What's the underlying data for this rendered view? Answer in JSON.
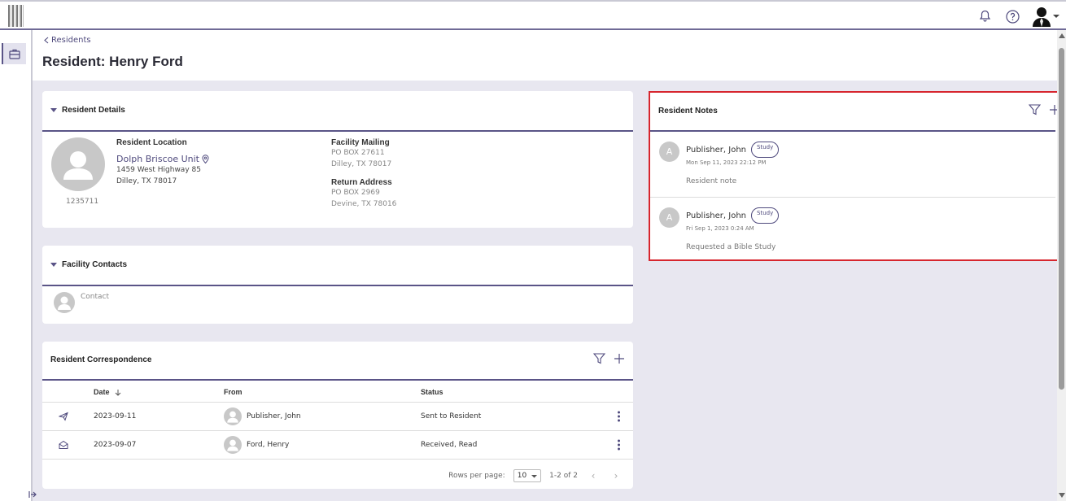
{
  "header": {
    "back_label": "Residents",
    "title": "Resident: Henry Ford"
  },
  "topbar_icons": [
    "bell-icon",
    "help-icon",
    "user-avatar-icon"
  ],
  "resident_details": {
    "title": "Resident Details",
    "id_number": "1235711",
    "location_label": "Resident Location",
    "unit": "Dolph Briscoe Unit",
    "address_line1": "1459 West Highway 85",
    "address_line2": "Dilley, TX 78017",
    "facility_mailing_label": "Facility Mailing",
    "facility_mailing_line1": "PO BOX 27611",
    "facility_mailing_line2": "Dilley, TX 78017",
    "return_address_label": "Return Address",
    "return_address_line1": "PO BOX 2969",
    "return_address_line2": "Devine, TX 78016"
  },
  "facility_contacts": {
    "title": "Facility Contacts",
    "contact": "Contact"
  },
  "correspondence": {
    "title": "Resident Correspondence",
    "columns": {
      "date": "Date",
      "from": "From",
      "status": "Status"
    },
    "rows": [
      {
        "icon": "send-icon",
        "date": "2023-09-11",
        "from": "Publisher, John",
        "status": "Sent to Resident"
      },
      {
        "icon": "envelope-open-icon",
        "date": "2023-09-07",
        "from": "Ford, Henry",
        "status": "Received, Read"
      }
    ],
    "rows_per_page_label": "Rows per page:",
    "rows_per_page": "10",
    "range": "1-2 of 2"
  },
  "notes": {
    "title": "Resident Notes",
    "items": [
      {
        "initial": "A",
        "author": "Publisher, John",
        "tag": "Study",
        "date": "Mon Sep 11, 2023 22:12 PM",
        "body": "Resident note"
      },
      {
        "initial": "A",
        "author": "Publisher, John",
        "tag": "Study",
        "date": "Fri Sep 1, 2023 0:24 AM",
        "body": "Requested a Bible Study"
      }
    ]
  },
  "colors": {
    "accent": "#5a5487",
    "highlight": "#d7262e",
    "background": "#e8e7f0"
  }
}
